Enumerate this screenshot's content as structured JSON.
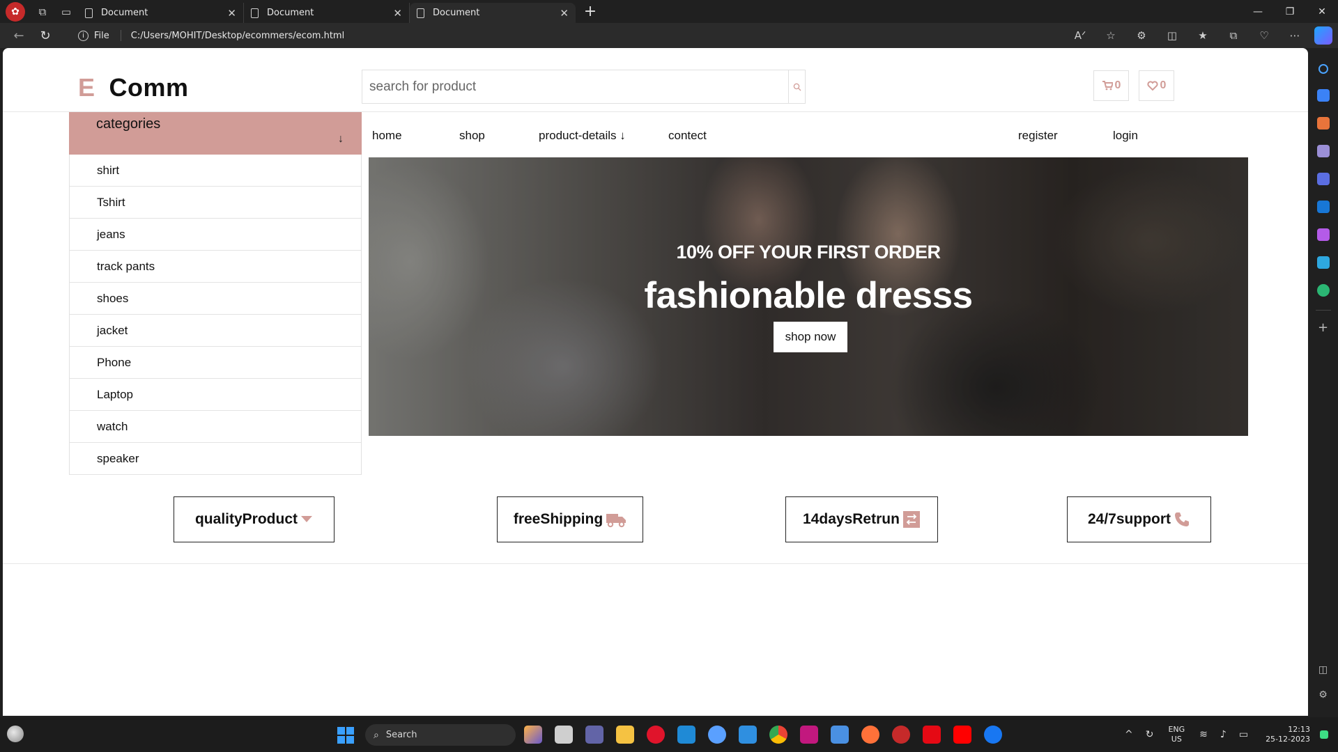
{
  "browser": {
    "tabs": [
      {
        "label": "Document"
      },
      {
        "label": "Document"
      },
      {
        "label": "Document"
      }
    ],
    "new_tab": "+",
    "address": {
      "scheme_label": "File",
      "url": "C:/Users/MOHIT/Desktop/ecommers/ecom.html"
    }
  },
  "site": {
    "logo": {
      "first": "E",
      "rest": "Comm"
    },
    "search": {
      "placeholder": "search for product"
    },
    "cart_count": "0",
    "favorites_count": "0",
    "categories": {
      "title": "categories",
      "items": [
        {
          "label": "shirt"
        },
        {
          "label": "Tshirt"
        },
        {
          "label": "jeans"
        },
        {
          "label": "track pants"
        },
        {
          "label": "shoes"
        },
        {
          "label": "jacket"
        },
        {
          "label": "Phone"
        },
        {
          "label": "Laptop"
        },
        {
          "label": "watch"
        },
        {
          "label": "speaker"
        }
      ]
    },
    "nav": {
      "home": "home",
      "shop": "shop",
      "product_details": "product-details ↓",
      "contact": "contect",
      "register": "register",
      "login": "login"
    },
    "hero": {
      "subtitle": "10% OFF YOUR FIRST ORDER",
      "title": "fashionable dresss",
      "button": "shop now"
    },
    "features": [
      {
        "label": "qualityProduct",
        "icon": "caret-down-icon"
      },
      {
        "label": "freeShipping",
        "icon": "truck-icon"
      },
      {
        "label": "14daysRetrun",
        "icon": "exchange-icon"
      },
      {
        "label": "24/7support",
        "icon": "phone-icon"
      }
    ],
    "accent_color": "#d19c97"
  },
  "taskbar": {
    "search_label": "Search",
    "language": {
      "line1": "ENG",
      "line2": "US"
    },
    "time": "12:13",
    "date": "25-12-2023"
  }
}
